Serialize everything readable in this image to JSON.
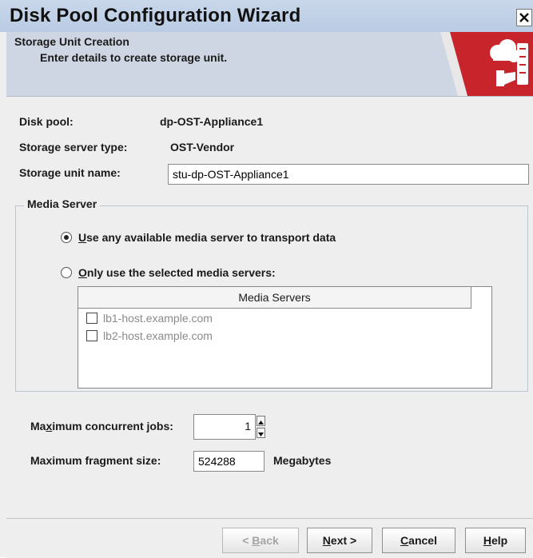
{
  "window": {
    "title": "Disk Pool Configuration Wizard",
    "close_glyph": "X"
  },
  "header": {
    "title": "Storage Unit Creation",
    "subtitle": "Enter details to create storage unit."
  },
  "form": {
    "disk_pool_label": "Disk pool:",
    "disk_pool_value": "dp-OST-Appliance1",
    "server_type_label": "Storage server type:",
    "server_type_value": "OST-Vendor",
    "unit_name_label": "Storage unit name:",
    "unit_name_value": "stu-dp-OST-Appliance1"
  },
  "media_server": {
    "group_title": "Media Server",
    "option_any": {
      "label": "Use any available media server to transport data",
      "selected": true
    },
    "option_selected": {
      "label": "Only use the selected media servers:",
      "selected": false
    },
    "list_header": "Media Servers",
    "servers": [
      {
        "name": "lb1-host.example.com",
        "checked": false
      },
      {
        "name": "lb2-host.example.com",
        "checked": false
      }
    ]
  },
  "limits": {
    "max_jobs_label": "Maximum concurrent jobs:",
    "max_jobs_value": "1",
    "max_fragment_label": "Maximum fragment size:",
    "max_fragment_value": "524288",
    "fragment_unit": "Megabytes"
  },
  "buttons": {
    "back": "< Back",
    "next": "Next >",
    "cancel": "Cancel",
    "help": "Help"
  },
  "colors": {
    "logo_red": "#c8242b",
    "header_bg": "#cdd6e2",
    "titlebar_bg": "#c9d7ea"
  }
}
